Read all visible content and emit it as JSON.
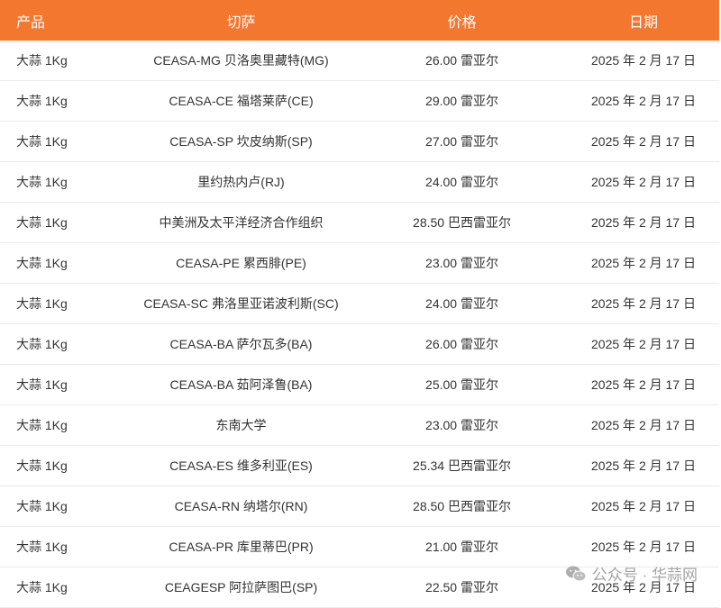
{
  "header": {
    "product": "产品",
    "market": "切萨",
    "price": "价格",
    "date": "日期"
  },
  "rows": [
    {
      "product": "大蒜 1Kg",
      "market": "CEASA-MG 贝洛奥里藏特(MG)",
      "price": "26.00 雷亚尔",
      "date": "2025 年 2 月 17 日"
    },
    {
      "product": "大蒜 1Kg",
      "market": "CEASA-CE 福塔莱萨(CE)",
      "price": "29.00 雷亚尔",
      "date": "2025 年 2 月 17 日"
    },
    {
      "product": "大蒜 1Kg",
      "market": "CEASA-SP 坎皮纳斯(SP)",
      "price": "27.00 雷亚尔",
      "date": "2025 年 2 月 17 日"
    },
    {
      "product": "大蒜 1Kg",
      "market": "里约热内卢(RJ)",
      "price": "24.00 雷亚尔",
      "date": "2025 年 2 月 17 日"
    },
    {
      "product": "大蒜 1Kg",
      "market": "中美洲及太平洋经济合作组织",
      "price": "28.50 巴西雷亚尔",
      "date": "2025 年 2 月 17 日"
    },
    {
      "product": "大蒜 1Kg",
      "market": "CEASA-PE 累西腓(PE)",
      "price": "23.00 雷亚尔",
      "date": "2025 年 2 月 17 日"
    },
    {
      "product": "大蒜 1Kg",
      "market": "CEASA-SC 弗洛里亚诺波利斯(SC)",
      "price": "24.00 雷亚尔",
      "date": "2025 年 2 月 17 日"
    },
    {
      "product": "大蒜 1Kg",
      "market": "CEASA-BA 萨尔瓦多(BA)",
      "price": "26.00 雷亚尔",
      "date": "2025 年 2 月 17 日"
    },
    {
      "product": "大蒜 1Kg",
      "market": "CEASA-BA 茹阿泽鲁(BA)",
      "price": "25.00 雷亚尔",
      "date": "2025 年 2 月 17 日"
    },
    {
      "product": "大蒜 1Kg",
      "market": "东南大学",
      "price": "23.00 雷亚尔",
      "date": "2025 年 2 月 17 日"
    },
    {
      "product": "大蒜 1Kg",
      "market": "CEASA-ES 维多利亚(ES)",
      "price": "25.34 巴西雷亚尔",
      "date": "2025 年 2 月 17 日"
    },
    {
      "product": "大蒜 1Kg",
      "market": "CEASA-RN 纳塔尔(RN)",
      "price": "28.50 巴西雷亚尔",
      "date": "2025 年 2 月 17 日"
    },
    {
      "product": "大蒜 1Kg",
      "market": "CEASA-PR 库里蒂巴(PR)",
      "price": "21.00 雷亚尔",
      "date": "2025 年 2 月 17 日"
    },
    {
      "product": "大蒜 1Kg",
      "market": "CEAGESP 阿拉萨图巴(SP)",
      "price": "22.50 雷亚尔",
      "date": "2025 年 2 月 17 日"
    }
  ],
  "watermark": {
    "text": "公众号 · 华蒜网",
    "icon": "wechat-icon"
  },
  "colors": {
    "header_bg": "#f47730",
    "header_text": "#ffffff",
    "row_divider": "#ebebeb"
  }
}
